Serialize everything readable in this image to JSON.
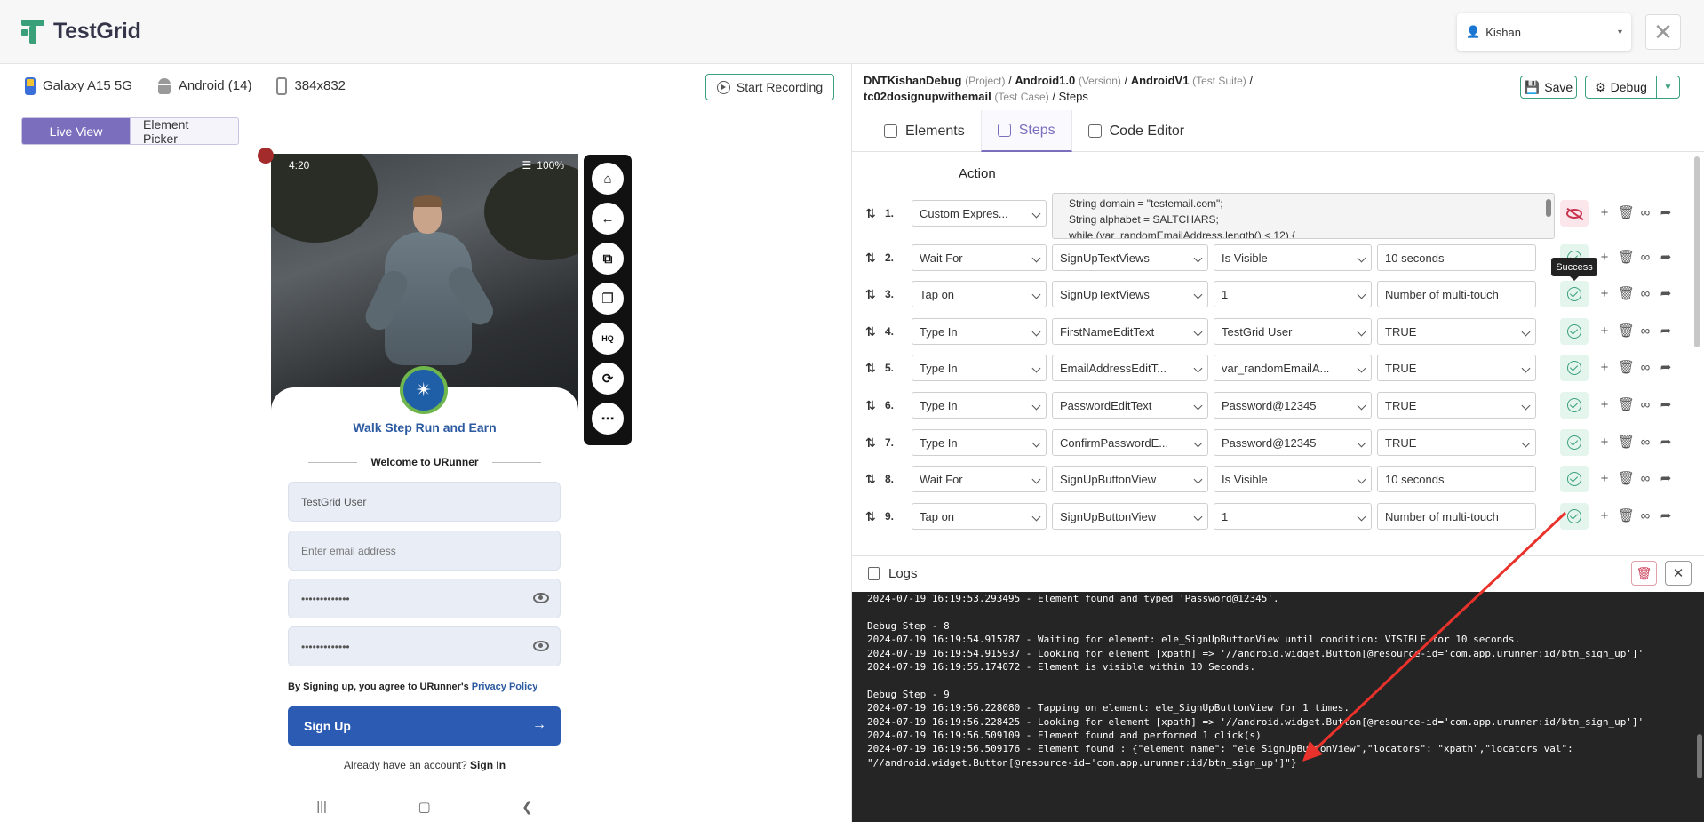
{
  "header": {
    "logo_text": "TestGrid",
    "user_name": "Kishan",
    "close_icon": "close-icon"
  },
  "device": {
    "name": "Galaxy A15 5G",
    "os": "Android (14)",
    "resolution": "384x832",
    "record_label": "Start Recording"
  },
  "view_toggle": {
    "live": "Live View",
    "picker": "Element Picker"
  },
  "phone": {
    "time": "4:20",
    "battery": "100%",
    "title": "Walk Step Run and Earn",
    "welcome": "Welcome to URunner",
    "name_value": "TestGrid User",
    "email_placeholder": "Enter email address",
    "password_mask": "•••••••••••••",
    "confirm_mask": "•••••••••••••",
    "agree_text": "By Signing up, you agree to URunner's ",
    "privacy": "Privacy Policy",
    "signup": "Sign Up",
    "have_account": "Already have an account? ",
    "signin": "Sign In"
  },
  "breadcrumb": {
    "project": "DNTKishanDebug",
    "project_meta": "(Project)",
    "version": "Android1.0",
    "version_meta": "(Version)",
    "suite": "AndroidV1",
    "suite_meta": "(Test Suite)",
    "case": "tc02dosignupwithemail",
    "case_meta": "(Test Case)",
    "steps": "Steps"
  },
  "toolbar": {
    "save": "Save",
    "debug": "Debug"
  },
  "tabs": [
    "Elements",
    "Steps",
    "Code Editor"
  ],
  "steps_header": "Action",
  "tooltip": "Success",
  "step1": {
    "num": "1.",
    "action": "Custom Expres...",
    "code": [
      "String domain = \"testemail.com\";",
      "String alphabet = SALTCHARS;",
      "while (var_randomEmailAddress.length() < 12) {"
    ]
  },
  "steps": [
    {
      "num": "2.",
      "action": "Wait For",
      "element": "SignUpTextViews",
      "value": "Is Visible",
      "extra": "10 seconds"
    },
    {
      "num": "3.",
      "action": "Tap on",
      "element": "SignUpTextViews",
      "value": "1",
      "extra": "Number of multi-touch"
    },
    {
      "num": "4.",
      "action": "Type In",
      "element": "FirstNameEditText",
      "value": "TestGrid User",
      "extra": "TRUE"
    },
    {
      "num": "5.",
      "action": "Type In",
      "element": "EmailAddressEditT...",
      "value": "var_randomEmailA...",
      "extra": "TRUE"
    },
    {
      "num": "6.",
      "action": "Type In",
      "element": "PasswordEditText",
      "value": "Password@12345",
      "extra": "TRUE"
    },
    {
      "num": "7.",
      "action": "Type In",
      "element": "ConfirmPasswordE...",
      "value": "Password@12345",
      "extra": "TRUE"
    },
    {
      "num": "8.",
      "action": "Wait For",
      "element": "SignUpButtonView",
      "value": "Is Visible",
      "extra": "10 seconds"
    },
    {
      "num": "9.",
      "action": "Tap on",
      "element": "SignUpButtonView",
      "value": "1",
      "extra": "Number of multi-touch"
    }
  ],
  "logs": {
    "title": "Logs",
    "lines": [
      "2024-07-19 16:19:53.293495 - Element found and typed 'Password@12345'.",
      "",
      "Debug Step - 8",
      "2024-07-19 16:19:54.915787 - Waiting for element: ele_SignUpButtonView until condition: VISIBLE for 10 seconds.",
      "2024-07-19 16:19:54.915937 - Looking for element [xpath] => '//android.widget.Button[@resource-id='com.app.urunner:id/btn_sign_up']'",
      "2024-07-19 16:19:55.174072 - Element is visible within 10 Seconds.",
      "",
      "Debug Step - 9",
      "2024-07-19 16:19:56.228080 - Tapping on element: ele_SignUpButtonView for 1 times.",
      "2024-07-19 16:19:56.228425 - Looking for element [xpath] => '//android.widget.Button[@resource-id='com.app.urunner:id/btn_sign_up']'",
      "2024-07-19 16:19:56.509109 - Element found and performed 1 click(s)",
      "2024-07-19 16:19:56.509176 - Element found : {\"element_name\": \"ele_SignUpButtonView\",\"locators\": \"xpath\",\"locators_val\":",
      "\"//android.widget.Button[@resource-id='com.app.urunner:id/btn_sign_up']\"}"
    ]
  },
  "colors": {
    "brand": "#3aa07a",
    "accent": "#7b6fbd",
    "annotation_arrow": "#e8322b"
  }
}
